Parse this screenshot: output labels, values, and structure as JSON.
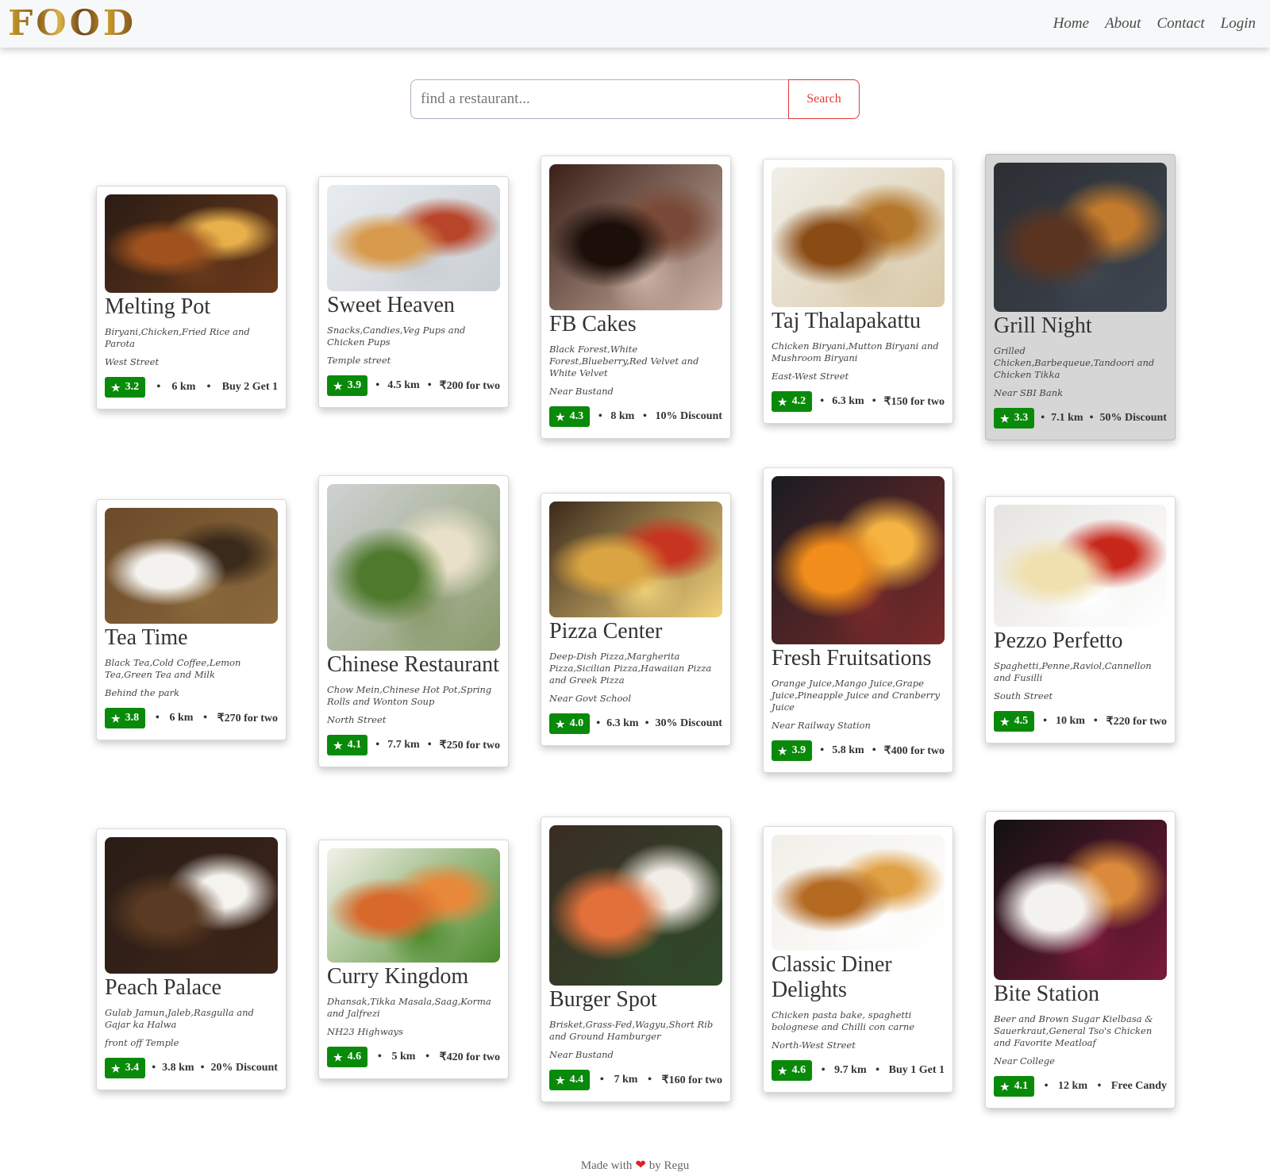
{
  "brand": {
    "logo": "FOOD"
  },
  "nav": {
    "links": [
      "Home",
      "About",
      "Contact",
      "Login"
    ]
  },
  "search": {
    "placeholder": "find a restaurant...",
    "button_label": "Search"
  },
  "colors": {
    "rating_bg": "#0a8a0a",
    "search_accent": "#e53935",
    "heart": "#e01d2d"
  },
  "restaurants": [
    {
      "name": "Melting Pot",
      "cuisine": "Biryani,Chicken,Fried Rice and Parota",
      "location": "West Street",
      "rating": "3.2",
      "distance": "6 km",
      "offer": "Buy 2 Get 1",
      "image": "indian-food-spread-image"
    },
    {
      "name": "Sweet Heaven",
      "cuisine": "Snacks,Candies,Veg Pups and Chicken Pups",
      "location": "Temple street",
      "rating": "3.9",
      "distance": "4.5 km",
      "offer": "₹200 for two",
      "image": "pancake-stack-image"
    },
    {
      "name": "FB Cakes",
      "cuisine": "Black Forest,White Forest,Blueberry,Red Velvet and White Velvet",
      "location": "Near Bustand",
      "rating": "4.3",
      "distance": "8 km",
      "offer": "10% Discount",
      "image": "chocolate-cake-slice-image"
    },
    {
      "name": "Taj Thalapakattu",
      "cuisine": "Chicken Biryani,Mutton Biryani and Mushroom Biryani",
      "location": "East-West Street",
      "rating": "4.2",
      "distance": "6.3 km",
      "offer": "₹150 for two",
      "image": "biryani-plate-image"
    },
    {
      "name": "Grill Night",
      "cuisine": "Grilled Chicken,Barbequeue,Tandoori and Chicken Tikka",
      "location": "Near SBI Bank",
      "rating": "3.3",
      "distance": "7.1 km",
      "offer": "50% Discount",
      "image": "grilled-chicken-image"
    },
    {
      "name": "Tea Time",
      "cuisine": "Black Tea,Cold Coffee,Lemon Tea,Green Tea and Milk",
      "location": "Behind the park",
      "rating": "3.8",
      "distance": "6 km",
      "offer": "₹270 for two",
      "image": "coffee-cup-image"
    },
    {
      "name": "Chinese Restaurant",
      "cuisine": "Chow Mein,Chinese Hot Pot,Spring Rolls and Wonton Soup",
      "location": "North Street",
      "rating": "4.1",
      "distance": "7.7 km",
      "offer": "₹250 for two",
      "image": "salad-plate-image"
    },
    {
      "name": "Pizza Center",
      "cuisine": "Deep-Dish Pizza,Margherita Pizza,Sicilian Pizza,Hawaiian Pizza and Greek Pizza",
      "location": "Near Govt School",
      "rating": "4.0",
      "distance": "6.3 km",
      "offer": "30% Discount",
      "image": "pizza-image"
    },
    {
      "name": "Fresh Fruitsations",
      "cuisine": "Orange Juice,Mango Juice,Grape Juice,Pineapple Juice and Cranberry Juice",
      "location": "Near Railway Station",
      "rating": "3.9",
      "distance": "5.8 km",
      "offer": "₹400 for two",
      "image": "orange-juice-glass-image"
    },
    {
      "name": "Pezzo Perfetto",
      "cuisine": "Spaghetti,Penne,Raviol,Cannellon and Fusilli",
      "location": "South Street",
      "rating": "4.5",
      "distance": "10 km",
      "offer": "₹220 for two",
      "image": "pasta-plate-image"
    },
    {
      "name": "Peach Palace",
      "cuisine": "Gulab Jamun,Jaleb,Rasgulla and Gajar ka Halwa",
      "location": "front off Temple",
      "rating": "3.4",
      "distance": "3.8 km",
      "offer": "20% Discount",
      "image": "chocolate-dessert-image"
    },
    {
      "name": "Curry Kingdom",
      "cuisine": "Dhansak,Tikka Masala,Saag,Korma and Jalfrezi",
      "location": "NH23 Highways",
      "rating": "4.6",
      "distance": "5 km",
      "offer": "₹420 for two",
      "image": "chicken-rice-image"
    },
    {
      "name": "Burger Spot",
      "cuisine": "Brisket,Grass-Fed,Wagyu,Short Rib and Ground Hamburger",
      "location": "Near Bustand",
      "rating": "4.4",
      "distance": "7 km",
      "offer": "₹160 for two",
      "image": "sushi-roll-image"
    },
    {
      "name": "Classic Diner Delights",
      "cuisine": "Chicken pasta bake, spaghetti bolognese and Chilli con carne",
      "location": "North-West Street",
      "rating": "4.6",
      "distance": "9.7 km",
      "offer": "Buy 1 Get 1",
      "image": "fried-chicken-plate-image"
    },
    {
      "name": "Bite Station",
      "cuisine": "Beer and Brown Sugar Kielbasa & Sauerkraut,General Tso's Chicken and Favorite Meatloaf",
      "location": "Near College",
      "rating": "4.1",
      "distance": "12 km",
      "offer": "Free Candy",
      "image": "bento-box-image"
    }
  ],
  "footer": {
    "prefix": "Made with",
    "suffix": "by Regu",
    "icon": "heart-icon"
  }
}
